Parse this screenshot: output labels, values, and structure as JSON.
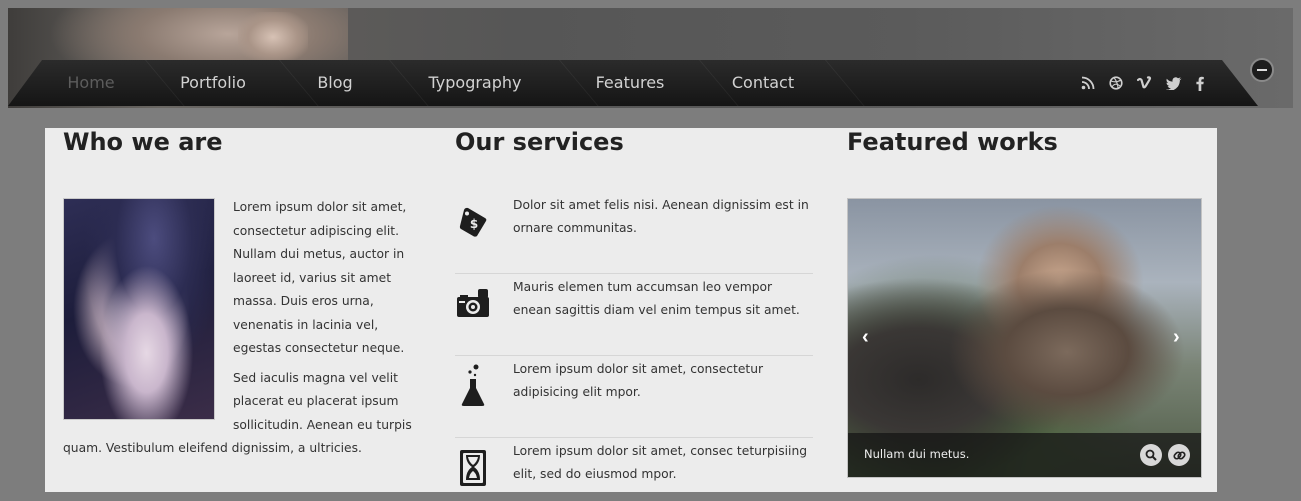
{
  "nav": {
    "items": [
      {
        "label": "Home",
        "active": true
      },
      {
        "label": "Portfolio",
        "active": false
      },
      {
        "label": "Blog",
        "active": false
      },
      {
        "label": "Typography",
        "active": false
      },
      {
        "label": "Features",
        "active": false
      },
      {
        "label": "Contact",
        "active": false
      }
    ],
    "social_icons": [
      "rss-icon",
      "dribbble-icon",
      "vimeo-icon",
      "twitter-icon",
      "facebook-icon"
    ]
  },
  "who": {
    "title": "Who we are",
    "para1": "Lorem ipsum dolor sit amet, consectetur adipiscing elit. Nullam dui metus, auctor in laoreet id, varius sit amet massa. Duis eros urna, venenatis in lacinia vel, egestas consectetur neque.",
    "para2": "Sed iaculis magna vel velit placerat eu placerat ipsum sollicitudin. Aenean eu turpis quam. Vestibulum eleifend dignissim, a ultricies."
  },
  "services": {
    "title": "Our services",
    "items": [
      {
        "icon": "price-tag-icon",
        "text": "Dolor sit amet felis nisi. Aenean dignissim est in ornare communitas."
      },
      {
        "icon": "camera-icon",
        "text": "Mauris elemen tum accumsan leo vempor enean sagittis diam vel enim tempus sit amet."
      },
      {
        "icon": "flask-icon",
        "text": "Lorem ipsum dolor sit amet, consectetur adipisicing elit mpor."
      },
      {
        "icon": "hourglass-icon",
        "text": "Lorem ipsum dolor sit amet, consec teturpisiing elit, sed do eiusmod mpor."
      }
    ]
  },
  "featured": {
    "title": "Featured works",
    "caption": "Nullam dui metus.",
    "prev_symbol": "‹",
    "next_symbol": "›"
  }
}
